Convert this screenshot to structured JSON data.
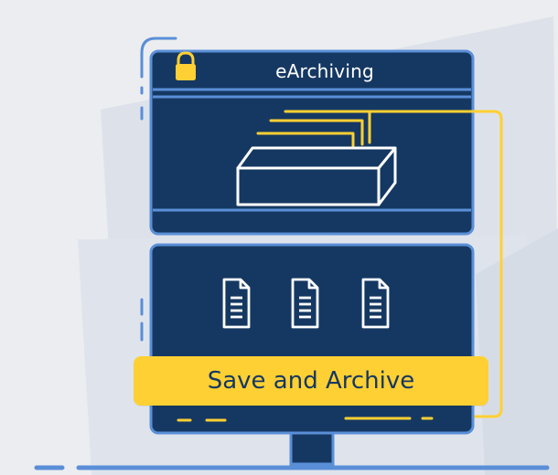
{
  "window": {
    "title": "eArchiving",
    "lock_icon": "padlock-icon"
  },
  "archive_box_icon": "archive-box-icon",
  "documents": [
    {
      "icon": "document-icon"
    },
    {
      "icon": "document-icon"
    },
    {
      "icon": "document-icon"
    }
  ],
  "action": {
    "label": "Save and Archive"
  },
  "colors": {
    "background": "#ecedf0",
    "navy": "#153862",
    "accent_blue": "#5a8fd8",
    "yellow": "#ffd033"
  }
}
